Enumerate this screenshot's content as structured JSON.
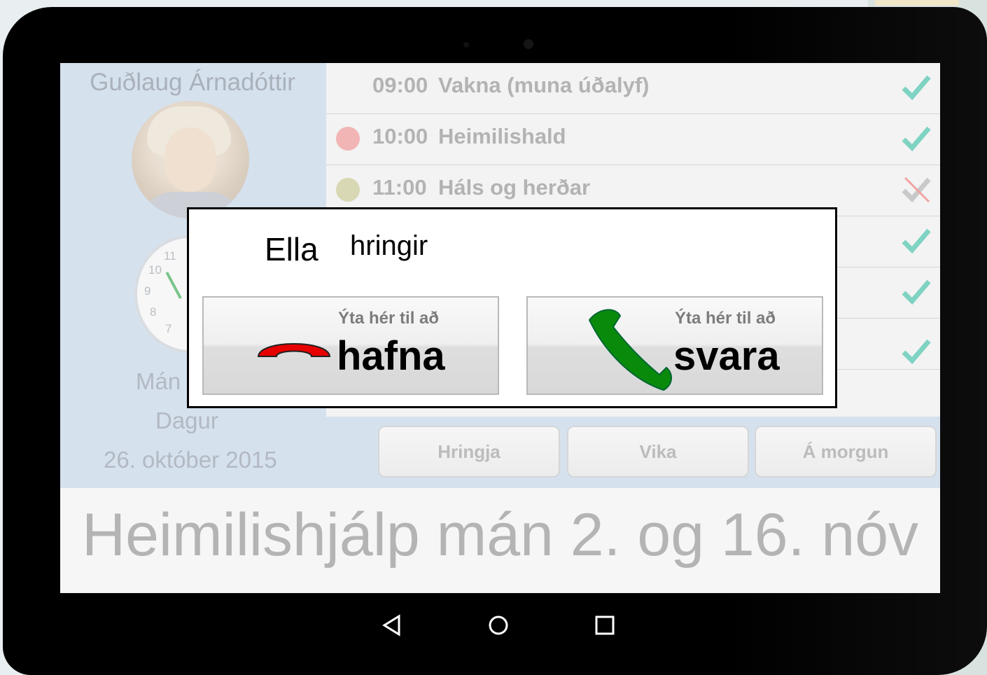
{
  "profile": {
    "name": "Guðlaug Árnadóttir",
    "day_partial": "Mán",
    "period": "Dagur",
    "date": "26. október 2015"
  },
  "clock": {
    "numerals": [
      "11",
      "10",
      "9",
      "8",
      "7"
    ]
  },
  "schedule": {
    "items": [
      {
        "time": "09:00",
        "task": "Vakna (muna úðalyf)",
        "dot_color": "",
        "status": "done"
      },
      {
        "time": "10:00",
        "task": "Heimilishald",
        "dot_color": "#f2b5b5",
        "status": "done"
      },
      {
        "time": "11:00",
        "task": "Háls og herðar",
        "dot_color": "#d8d8b5",
        "status": "missed"
      },
      {
        "time": "",
        "task": "",
        "dot_color": "",
        "status": "done"
      },
      {
        "time": "",
        "task": "",
        "dot_color": "",
        "status": "done"
      },
      {
        "time": "",
        "task": "",
        "dot_color": "",
        "status": "done"
      }
    ]
  },
  "buttons": {
    "call": "Hringja",
    "week": "Vika",
    "tomorrow": "Á morgun"
  },
  "banner": {
    "text": "Heimilishjálp mán 2. og 16. nóv"
  },
  "navigation": {
    "back_icon": "back-triangle-icon",
    "home_icon": "home-circle-icon",
    "recents_icon": "recents-square-icon"
  },
  "incoming_call": {
    "caller": "Ella",
    "action": "hringir",
    "decline": {
      "hint": "Ýta hér til að",
      "label": "hafna",
      "icon": "hang-up-phone-icon",
      "color": "#e60000"
    },
    "accept": {
      "hint": "Ýta hér til að",
      "label": "svara",
      "icon": "answer-phone-icon",
      "color": "#0a8a0a"
    }
  },
  "colors": {
    "check_done": "#7fd3c2",
    "check_missed": "#f2a2a2",
    "panel": "#d6e1ee"
  }
}
